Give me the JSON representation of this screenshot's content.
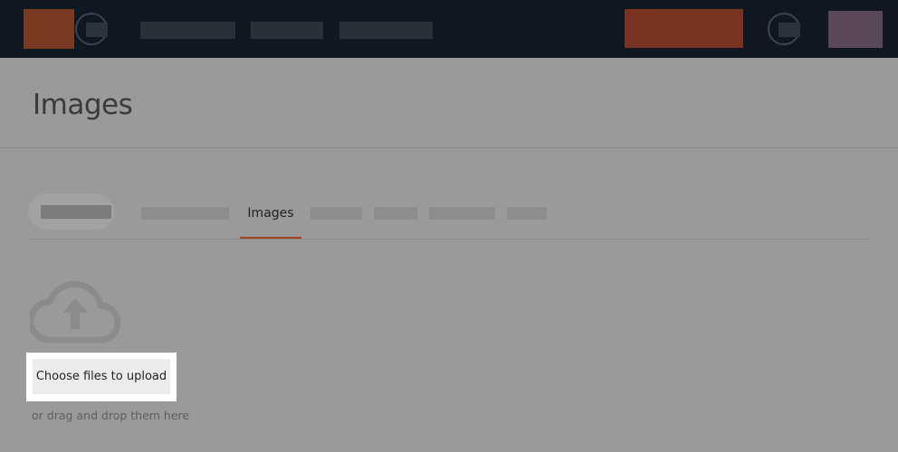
{
  "header": {
    "menu_icon": "menu-placeholder-icon",
    "user_icon": "user-placeholder-icon"
  },
  "page": {
    "title": "Images"
  },
  "tabs": {
    "active_label": "Images"
  },
  "upload": {
    "icon": "cloud-upload-icon",
    "button_label": "Choose files to upload",
    "hint": "or drag and drop them here"
  },
  "colors": {
    "topbar": "#0f1720",
    "accent": "#a04421",
    "overlay": "#9a9a9a",
    "highlight": "#ffffff"
  }
}
